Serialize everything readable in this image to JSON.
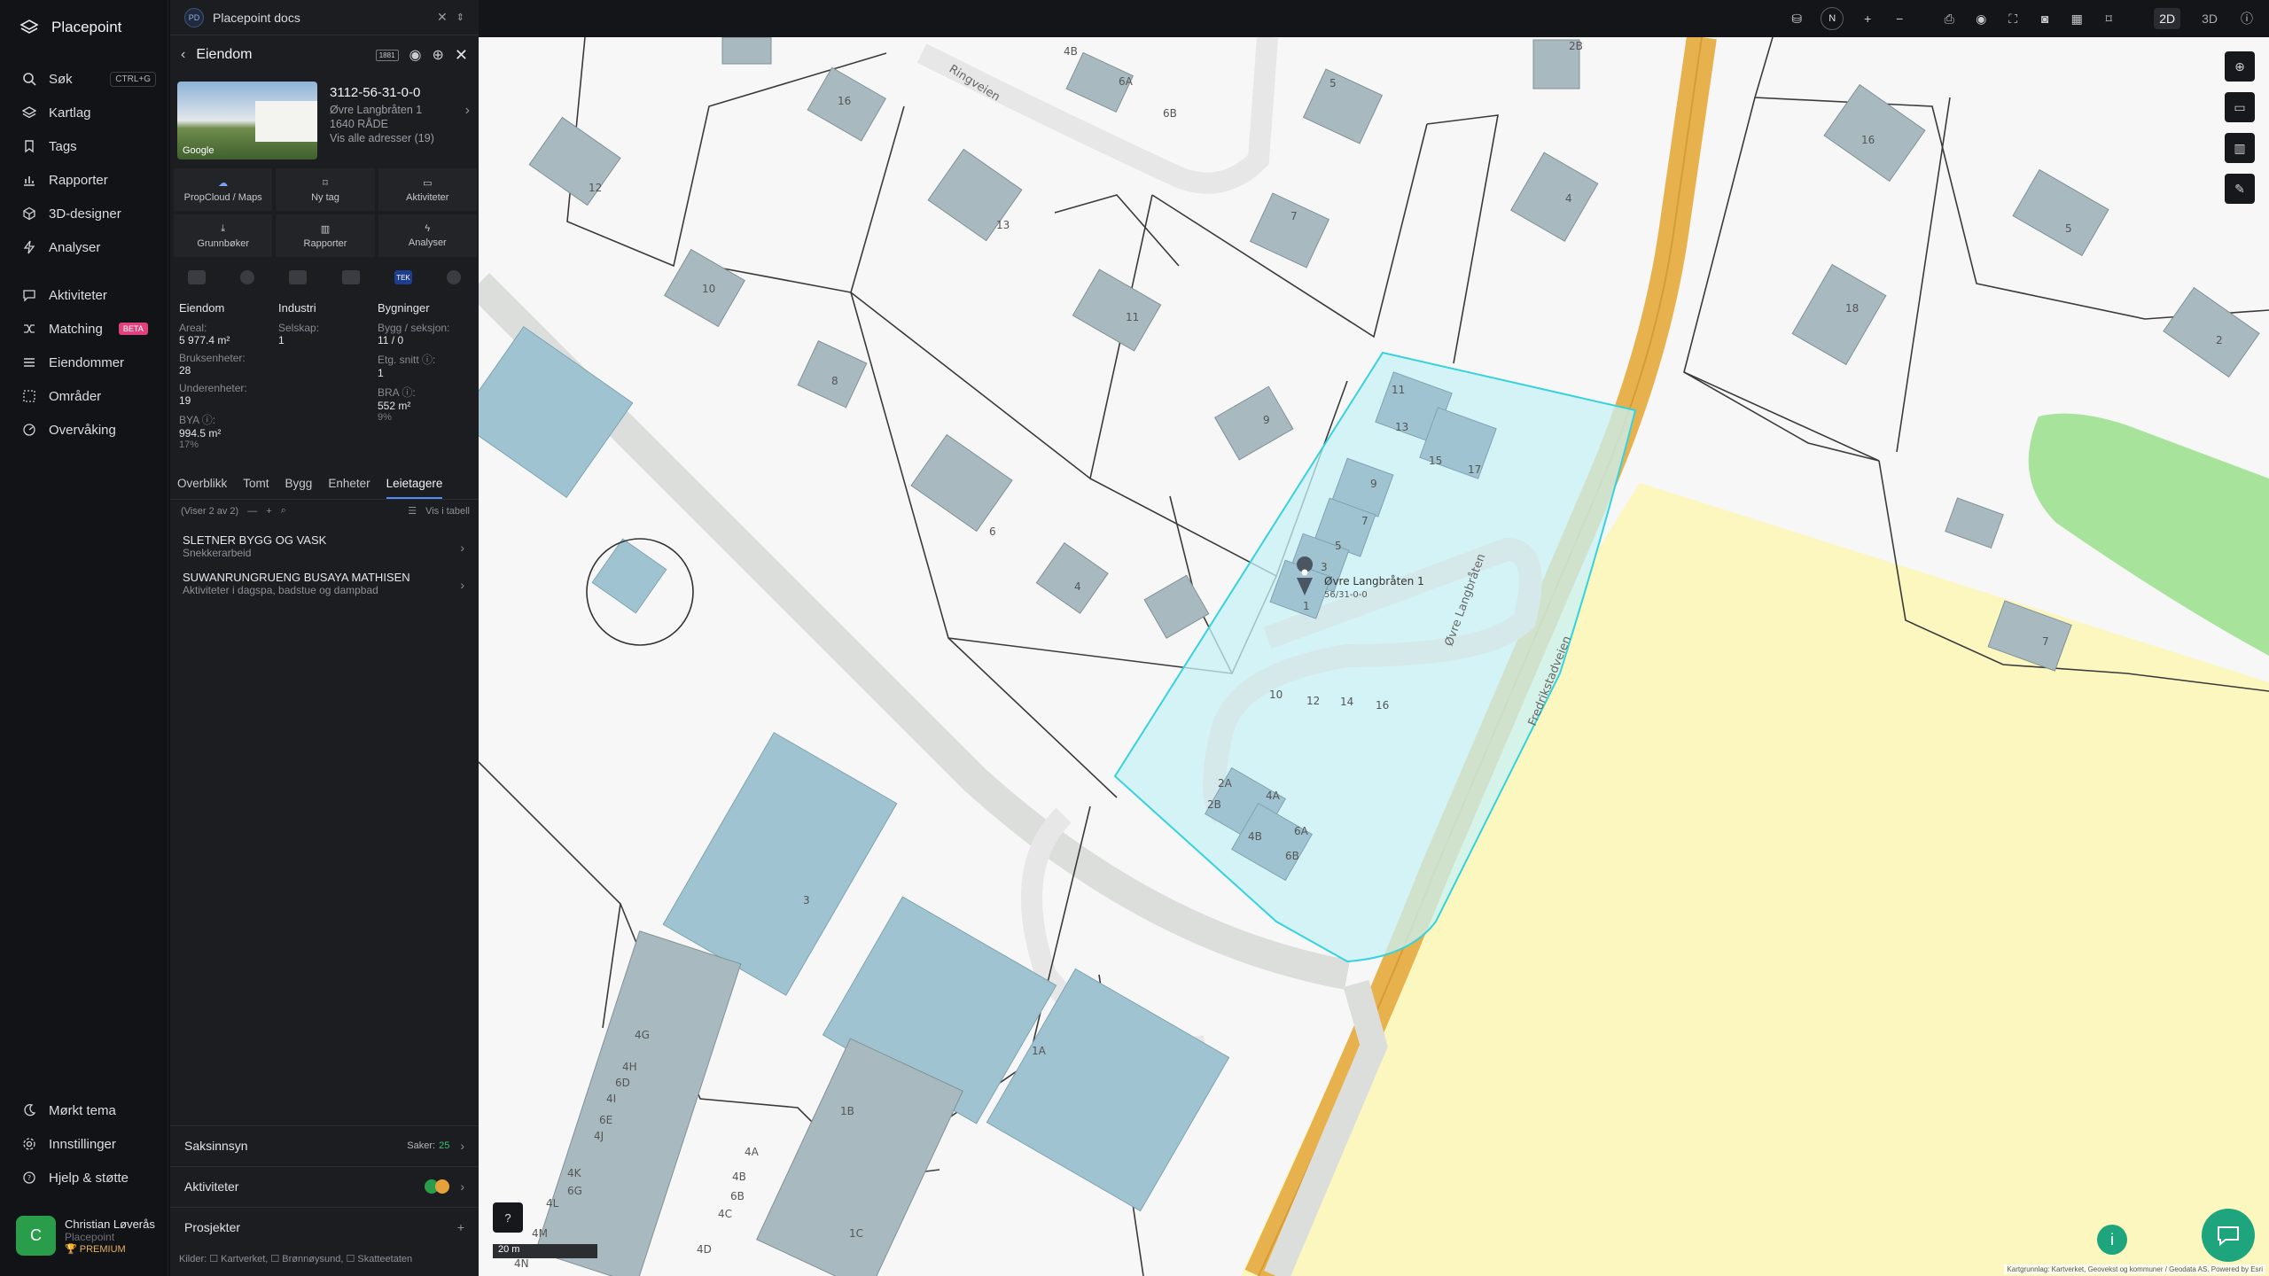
{
  "app": {
    "name": "Placepoint"
  },
  "nav": {
    "search": {
      "label": "Søk",
      "shortcut": "CTRL+G"
    },
    "items": [
      "Kartlag",
      "Tags",
      "Rapporter",
      "3D-designer",
      "Analyser"
    ],
    "items2": [
      "Aktiviteter",
      "Matching",
      "Eiendommer",
      "Områder",
      "Overvåking"
    ],
    "beta": "BETA",
    "bottom": [
      "Mørkt tema",
      "Innstillinger",
      "Hjelp & støtte"
    ]
  },
  "user": {
    "initial": "C",
    "name": "Christian Løverås",
    "org": "Placepoint",
    "plan": "PREMIUM"
  },
  "panel": {
    "badge": "PD",
    "doc_title": "Placepoint docs",
    "header": "Eiendom",
    "header_badge": "1881",
    "property": {
      "id": "3112-56-31-0-0",
      "address": "Øvre Langbråten 1",
      "postal": "1640 RÅDE",
      "all_addresses": "Vis alle adresser (19)",
      "photo_credit": "Google"
    },
    "actions": [
      "PropCloud / Maps",
      "Ny tag",
      "Aktiviteter",
      "Grunnbøker",
      "Rapporter",
      "Analyser"
    ],
    "tek_label": "TEK",
    "facts": {
      "col1": {
        "title": "Eiendom",
        "areal_label": "Areal:",
        "areal": "5 977.4 m²",
        "bruks_label": "Bruksenheter:",
        "bruks": "28",
        "under_label": "Underenheter:",
        "under": "19",
        "bya_label": "BYA ⓘ:",
        "bya": "994.5 m²",
        "bya_pct": "17%"
      },
      "col2": {
        "title": "Industri",
        "selskap_label": "Selskap:",
        "selskap": "1"
      },
      "col3": {
        "title": "Bygninger",
        "bygg_label": "Bygg / seksjon:",
        "bygg": "11 / 0",
        "etg_label": "Etg. snitt ⓘ:",
        "etg": "1",
        "bra_label": "BRA ⓘ:",
        "bra": "552 m²",
        "bra_pct": "9%"
      }
    },
    "subtabs": [
      "Overblikk",
      "Tomt",
      "Bygg",
      "Enheter",
      "Leietagere"
    ],
    "list_count": "(Viser 2 av 2)",
    "list_table": "Vis i tabell",
    "owners": [
      {
        "name": "SLETNER BYGG OG VASK",
        "desc": "Snekkerarbeid"
      },
      {
        "name": "SUWANRUNGRUENG BUSAYA MATHISEN",
        "desc": "Aktiviteter i dagspa, badstue og dampbad"
      }
    ],
    "sections": {
      "saksinnsyn": "Saksinnsyn",
      "saker_label": "Saker:",
      "saker": "25",
      "aktiviteter": "Aktiviteter",
      "prosjekter": "Prosjekter"
    },
    "sources": "Kilder: ☐ Kartverket, ☐ Brønnøysund, ☐ Skatteetaten"
  },
  "toolbar": {
    "compass": "N",
    "mode2d": "2D",
    "mode3d": "3D"
  },
  "map": {
    "roads": [
      "Ringveien",
      "Øvre Langbråten",
      "Fredrikstadveien"
    ],
    "selected_label": "Øvre Langbråten 1",
    "selected_sub": "56/31-0-0",
    "house_numbers": [
      "4B",
      "6A",
      "6B",
      "2B",
      "16",
      "12",
      "13",
      "10",
      "7",
      "5",
      "4",
      "11",
      "8",
      "9",
      "6",
      "4",
      "3",
      "11",
      "13",
      "15",
      "17",
      "9",
      "7",
      "5",
      "3",
      "1",
      "10",
      "12",
      "14",
      "16",
      "2A",
      "2B",
      "4A",
      "4B",
      "6A",
      "6B",
      "18",
      "16",
      "5",
      "2",
      "7",
      "1A",
      "1B",
      "1C",
      "4G",
      "4H",
      "6D",
      "4I",
      "6E",
      "4J",
      "4K",
      "6G",
      "4L",
      "4M",
      "4N",
      "4A",
      "4B",
      "6B",
      "4C",
      "4D",
      "3"
    ],
    "scale": "20 m",
    "attribution": "Kartgrunnlag: Kartverket, Geovekst og kommuner / Geodata AS. Powered by Esri"
  }
}
